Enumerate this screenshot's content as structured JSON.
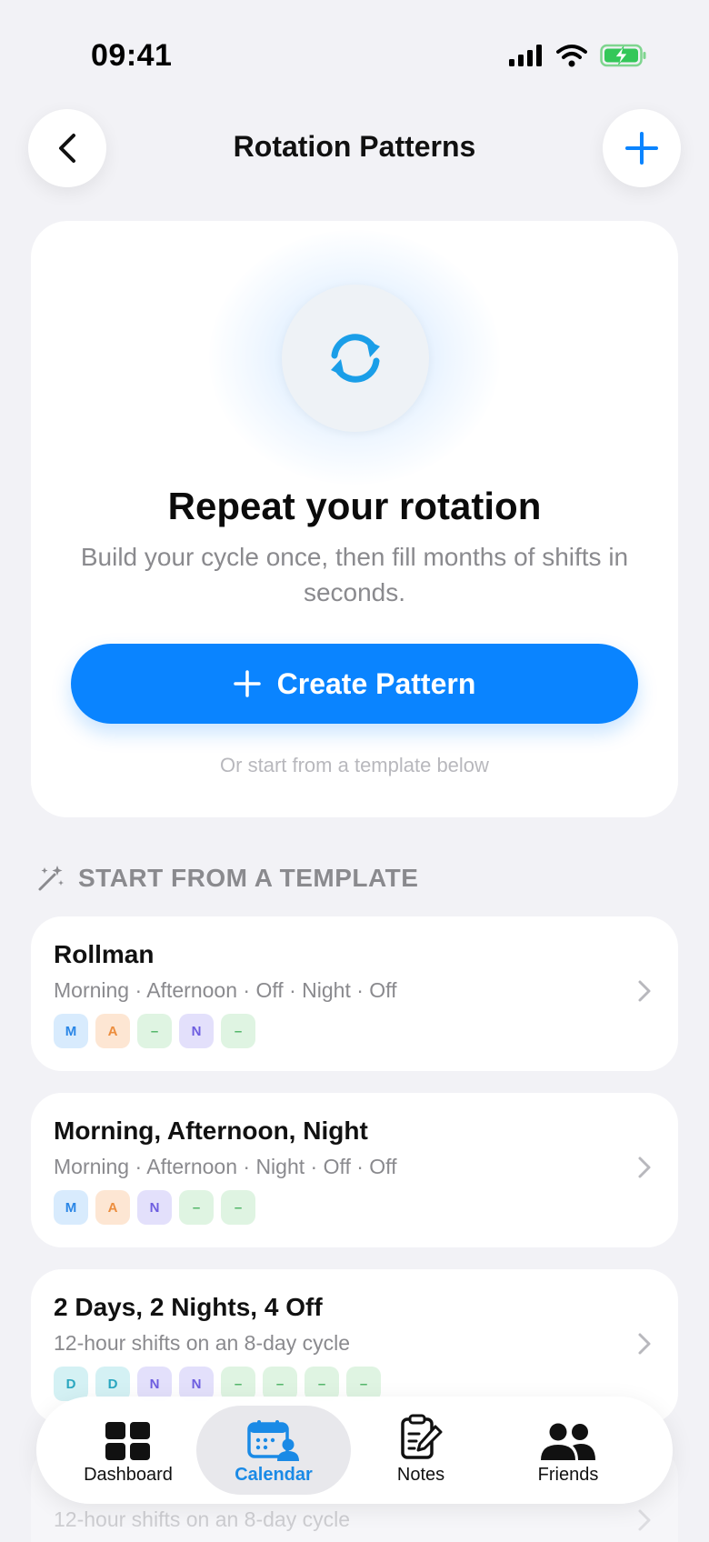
{
  "status_bar": {
    "time": "09:41"
  },
  "header": {
    "title": "Rotation Patterns"
  },
  "hero": {
    "title": "Repeat your rotation",
    "subtitle": "Build your cycle once, then fill months of shifts in seconds.",
    "create_label": "Create Pattern",
    "hint": "Or start from a template below"
  },
  "section": {
    "title": "START FROM A TEMPLATE"
  },
  "templates": [
    {
      "name": "Rollman",
      "description": "Morning · Afternoon · Off · Night · Off",
      "chips": [
        "M",
        "A",
        "–",
        "N",
        "–"
      ]
    },
    {
      "name": "Morning, Afternoon, Night",
      "description": "Morning · Afternoon · Night · Off · Off",
      "chips": [
        "M",
        "A",
        "N",
        "–",
        "–"
      ]
    },
    {
      "name": "2 Days, 2 Nights, 4 Off",
      "description": "12-hour shifts on an 8-day cycle",
      "chips": [
        "D",
        "D",
        "N",
        "N",
        "–",
        "–",
        "–",
        "–"
      ]
    },
    {
      "name": "",
      "description": "12-hour shifts on an 8-day cycle",
      "chips": []
    }
  ],
  "tabs": [
    {
      "label": "Dashboard",
      "icon": "grid-icon"
    },
    {
      "label": "Calendar",
      "icon": "calendar-person-icon",
      "active": true
    },
    {
      "label": "Notes",
      "icon": "notes-icon"
    },
    {
      "label": "Friends",
      "icon": "friends-icon"
    }
  ],
  "colors": {
    "accent": "#0a84ff",
    "background": "#f2f2f6",
    "secondary_text": "#8a8a8e",
    "battery": "#34c759"
  }
}
